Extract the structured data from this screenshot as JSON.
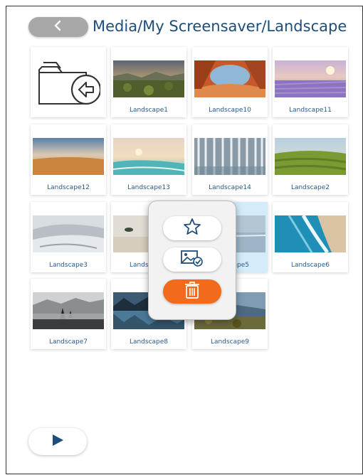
{
  "header": {
    "breadcrumb": "Media/My Screensaver/Landscape"
  },
  "grid": {
    "items": [
      {
        "label": "Landscape1"
      },
      {
        "label": "Landscape10"
      },
      {
        "label": "Landscape11"
      },
      {
        "label": "Landscape12"
      },
      {
        "label": "Landscape13"
      },
      {
        "label": "Landscape14"
      },
      {
        "label": "Landscape2"
      },
      {
        "label": "Landscape3"
      },
      {
        "label": "Landscape4"
      },
      {
        "label": "Landscape5"
      },
      {
        "label": "Landscape6"
      },
      {
        "label": "Landscape7"
      },
      {
        "label": "Landscape8"
      },
      {
        "label": "Landscape9"
      }
    ],
    "selected_item": "Landscape5"
  },
  "context_menu": {
    "actions": [
      "favorite",
      "set-as-screensaver",
      "delete"
    ]
  },
  "colors": {
    "title": "#1e4d7b",
    "label": "#2a5a8a",
    "delete_accent": "#f26a1b",
    "selected_tile": "#d4ecfa",
    "back_button": "#a8a8a8",
    "play_icon": "#1e4d7b"
  }
}
